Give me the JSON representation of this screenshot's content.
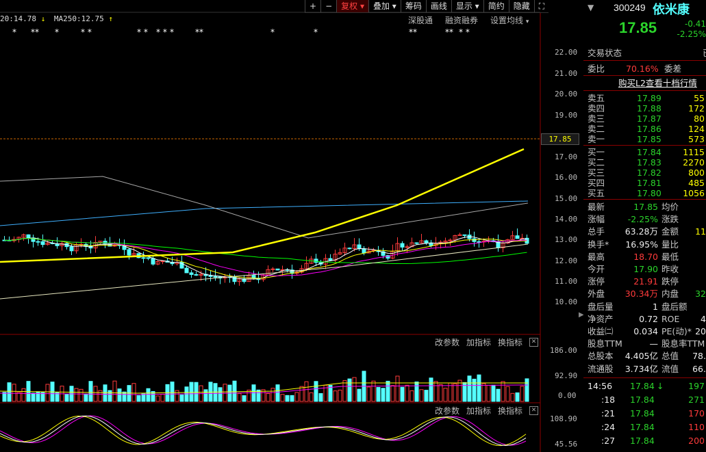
{
  "colors": {
    "up": "#ff3b3b",
    "down": "#54ffff",
    "ma5": "#ffffff",
    "ma10": "#ffff00",
    "ma20": "#ff00ff",
    "ma60": "#00ff00",
    "frame": "#8b0000"
  },
  "toolbar": {
    "items": [
      "+",
      "−",
      "复权",
      "叠加",
      "筹码",
      "画线",
      "显示",
      "简约",
      "隐藏"
    ],
    "active": "复权"
  },
  "ma_legend": {
    "prefix": "20:14.78",
    "ma250": "MA250:12.75"
  },
  "chart_links": [
    "深股通",
    "融资融券",
    "设置均线"
  ],
  "star_marks": [
    "*",
    "**",
    "*",
    "* *",
    "* *",
    "* *",
    "* ",
    "**",
    "*",
    "*",
    "**",
    "**",
    "* *"
  ],
  "price_axis": [
    "22.00",
    "21.00",
    "20.00",
    "19.00",
    "17.00",
    "16.00",
    "15.00",
    "14.00",
    "13.00",
    "12.00",
    "11.00",
    "10.00"
  ],
  "current_price_tag": "17.85",
  "volume_panel": {
    "links": [
      "改参数",
      "加指标",
      "换指标"
    ],
    "axis": [
      "186.00",
      "92.90",
      "0.00"
    ]
  },
  "indicator_panel": {
    "links": [
      "改参数",
      "加指标",
      "换指标"
    ],
    "axis": [
      "108.90",
      "45.56"
    ]
  },
  "quote": {
    "code": "300249",
    "name": "依米康",
    "price": "17.85",
    "change": "-0.41",
    "change_pct": "-2.25%",
    "status_label": "交易状态",
    "status_value": "已",
    "wb_label": "委比",
    "wb_value": "70.16%",
    "wc_label": "委差",
    "l2_link": "购买L2查看十档行情",
    "asks": [
      {
        "label": "卖五",
        "price": "17.89",
        "vol": "55"
      },
      {
        "label": "卖四",
        "price": "17.88",
        "vol": "172"
      },
      {
        "label": "卖三",
        "price": "17.87",
        "vol": "80"
      },
      {
        "label": "卖二",
        "price": "17.86",
        "vol": "124"
      },
      {
        "label": "卖一",
        "price": "17.85",
        "vol": "573"
      }
    ],
    "bids": [
      {
        "label": "买一",
        "price": "17.84",
        "vol": "1115"
      },
      {
        "label": "买二",
        "price": "17.83",
        "vol": "2270"
      },
      {
        "label": "买三",
        "price": "17.82",
        "vol": "800"
      },
      {
        "label": "买四",
        "price": "17.81",
        "vol": "485"
      },
      {
        "label": "买五",
        "price": "17.80",
        "vol": "1056"
      }
    ],
    "stats": [
      {
        "l1": "最新",
        "v1": "17.85",
        "c1": "green",
        "l2": "均价",
        "v2": "",
        "c2": "white"
      },
      {
        "l1": "涨幅",
        "v1": "-2.25%",
        "c1": "green",
        "l2": "涨跌",
        "v2": "",
        "c2": "green"
      },
      {
        "l1": "总手",
        "v1": "63.28万",
        "c1": "white",
        "l2": "金额",
        "v2": "11",
        "c2": "yellow"
      },
      {
        "l1": "换手*",
        "v1": "16.95%",
        "c1": "white",
        "l2": "量比",
        "v2": "",
        "c2": "white"
      },
      {
        "l1": "最高",
        "v1": "18.70",
        "c1": "red",
        "l2": "最低",
        "v2": "",
        "c2": "white"
      },
      {
        "l1": "今开",
        "v1": "17.90",
        "c1": "green",
        "l2": "昨收",
        "v2": "",
        "c2": "white"
      },
      {
        "l1": "涨停",
        "v1": "21.91",
        "c1": "red",
        "l2": "跌停",
        "v2": "",
        "c2": "white"
      },
      {
        "l1": "外盘",
        "v1": "30.34万",
        "c1": "red",
        "l2": "内盘",
        "v2": "32",
        "c2": "green"
      },
      {
        "l1": "盘后量",
        "v1": "1",
        "c1": "white",
        "l2": "盘后额",
        "v2": "",
        "c2": "white"
      },
      {
        "l1": "净资产",
        "v1": "0.72",
        "c1": "white",
        "l2": "ROE",
        "v2": "4",
        "c2": "white"
      },
      {
        "l1": "收益㈡",
        "v1": "0.034",
        "c1": "white",
        "l2": "PE(动)*",
        "v2": "20",
        "c2": "white"
      },
      {
        "l1": "股息TTM",
        "v1": "—",
        "c1": "white",
        "l2": "股息率TTM",
        "v2": "",
        "c2": "white"
      },
      {
        "l1": "总股本",
        "v1": "4.405亿",
        "c1": "white",
        "l2": "总值",
        "v2": "78.",
        "c2": "white"
      },
      {
        "l1": "流通股",
        "v1": "3.734亿",
        "c1": "white",
        "l2": "流值",
        "v2": "66.",
        "c2": "white"
      }
    ],
    "ticks": [
      {
        "t": "14:56",
        "p": "17.84",
        "arrow": "↓",
        "v": "197",
        "vc": "green"
      },
      {
        "t": ":18",
        "p": "17.84",
        "arrow": "",
        "v": "271",
        "vc": "green"
      },
      {
        "t": ":21",
        "p": "17.84",
        "arrow": "",
        "v": "170",
        "vc": "red"
      },
      {
        "t": ":24",
        "p": "17.84",
        "arrow": "",
        "v": "110",
        "vc": "red"
      },
      {
        "t": ":27",
        "p": "17.84",
        "arrow": "",
        "v": "200",
        "vc": "red"
      }
    ]
  }
}
